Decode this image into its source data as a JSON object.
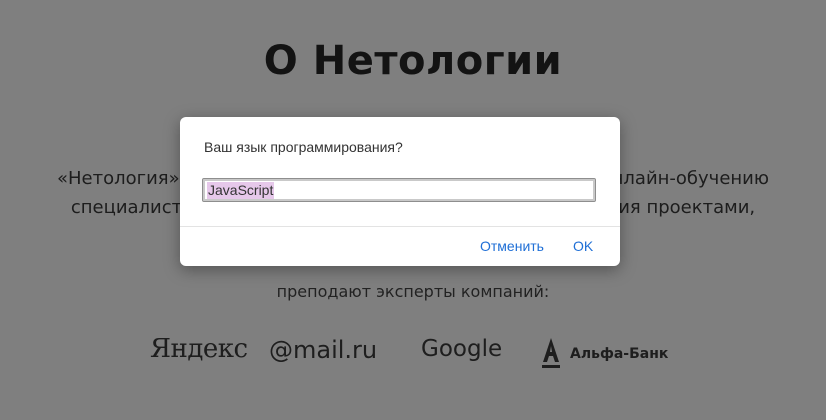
{
  "page": {
    "title": "О Нетологии",
    "intro_lines": [
      "«Нетология» – ведущая образовательная платформа по онлайн-обучению",
      "специалистов в области интернет-маркетинга, управления проектами, дизайна,"
    ],
    "partners_caption": "преподают эксперты компаний:",
    "logos": {
      "yandex": "Яндекс",
      "mail": "@mail.ru",
      "google": "Google",
      "alfa": "Альфа-Банк"
    }
  },
  "dialog": {
    "message": "Ваш язык программирования?",
    "input_value": "JavaScript",
    "cancel_label": "Отменить",
    "ok_label": "OK"
  },
  "colors": {
    "overlay": "#000000",
    "link": "#1f6fd6",
    "selection": "#e6c8ea"
  }
}
